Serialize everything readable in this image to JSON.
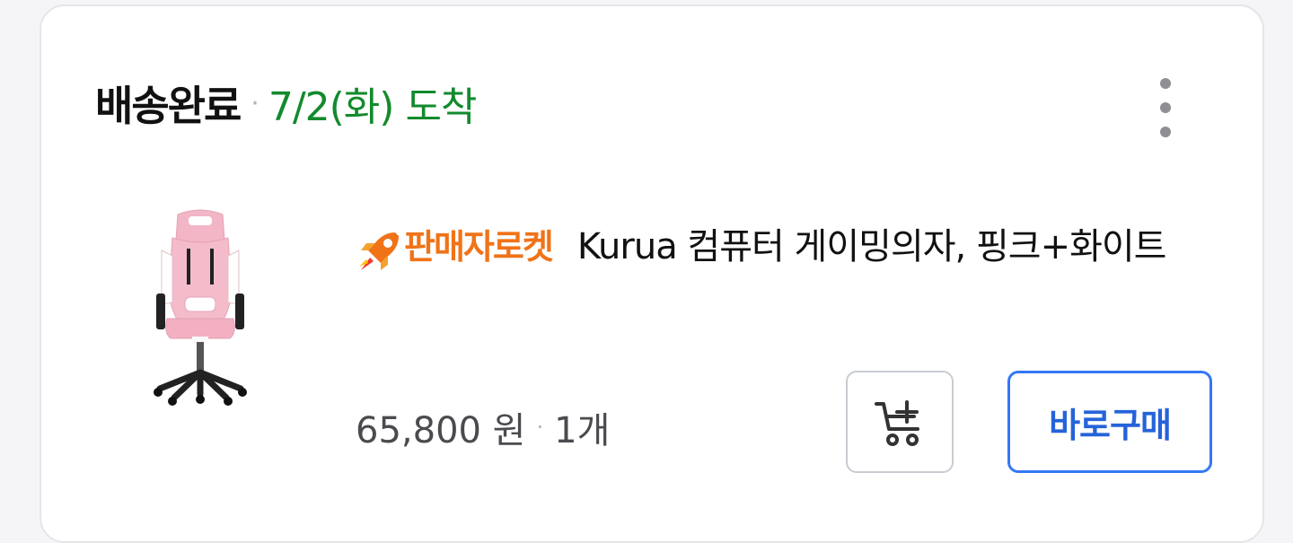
{
  "order": {
    "status": "배송완료",
    "separator": "·",
    "arrival": "7/2(화) 도착"
  },
  "more_menu": {
    "icon": "more-vertical-icon"
  },
  "item": {
    "badge_icon": "rocket-icon",
    "badge_label": "판매자로켓",
    "title": "Kurua 컴퓨터 게이밍의자, 핑크+화이트",
    "price": "65,800 원",
    "separator": "·",
    "quantity": "1개"
  },
  "actions": {
    "cart_icon": "add-to-cart-icon",
    "buy_label": "바로구매"
  },
  "colors": {
    "arrival": "#128a2d",
    "badge": "#f07318",
    "buy_accent": "#3477f5"
  }
}
